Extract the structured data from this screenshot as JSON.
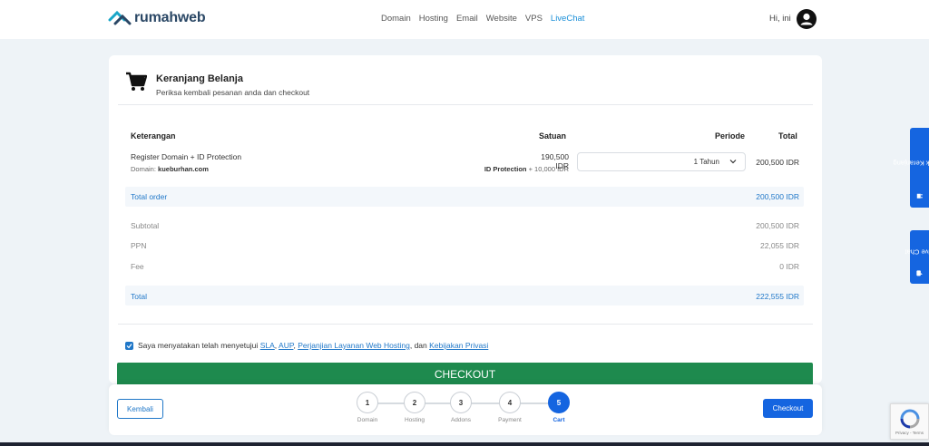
{
  "header": {
    "brand": "rumahweb",
    "nav": [
      "Domain",
      "Hosting",
      "Email",
      "Website",
      "VPS",
      "LiveChat"
    ],
    "nav_active": "LiveChat",
    "greeting": "Hi, ini"
  },
  "cart": {
    "title": "Keranjang Belanja",
    "subtitle": "Periksa kembali pesanan anda dan checkout",
    "columns": {
      "description": "Keterangan",
      "unit": "Satuan",
      "period": "Periode",
      "total": "Total"
    },
    "item": {
      "name": "Register Domain + ID Protection",
      "domain_label": "Domain:",
      "domain": "kueburhan.com",
      "price": "190,500 IDR",
      "addon_name": "ID Protection",
      "addon_price": "+ 10,000 IDR",
      "period": "1 Tahun",
      "total": "200,500 IDR"
    },
    "total_order_label": "Total order",
    "total_order_value": "200,500 IDR",
    "subtotal_label": "Subtotal",
    "subtotal_value": "200,500 IDR",
    "ppn_label": "PPN",
    "ppn_value": "22,055 IDR",
    "fee_label": "Fee",
    "fee_value": "0 IDR",
    "total_label": "Total",
    "total_value": "222,555 IDR"
  },
  "agreement": {
    "prefix": "Saya menyatakan telah menyetujui",
    "sla": "SLA",
    "sep1": ",",
    "aup": "AUP",
    "sep2": ",",
    "service": "Perjanjian Layanan Web Hosting",
    "sep3": ", dan",
    "privacy": "Kebijakan Privasi"
  },
  "checkout_big_label": "CHECKOUT",
  "bottom": {
    "back_label": "Kembali",
    "checkout_label": "Checkout",
    "steps": [
      {
        "num": "1",
        "label": "Domain"
      },
      {
        "num": "2",
        "label": "Hosting"
      },
      {
        "num": "3",
        "label": "Addons"
      },
      {
        "num": "4",
        "label": "Payment"
      },
      {
        "num": "5",
        "label": "Cart"
      }
    ],
    "active_step": 5
  },
  "side_tabs": {
    "cart": "Check Keranjang",
    "chat": "Live Chat"
  },
  "recaptcha": {
    "links": "Privacy - Terms"
  },
  "colors": {
    "primary": "#1565e0",
    "checkout_green": "#1e8a4e",
    "link_blue": "#1f77c8",
    "brand_dark": "#2a4765",
    "brand_teal": "#1aa6c8"
  }
}
